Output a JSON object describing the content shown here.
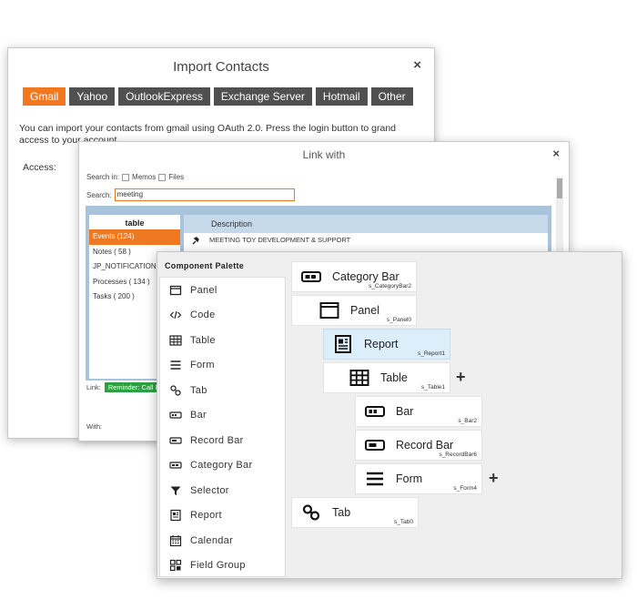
{
  "import_contacts": {
    "title": "Import Contacts",
    "close": "×",
    "tabs": [
      "Gmail",
      "Yahoo",
      "OutlookExpress",
      "Exchange Server",
      "Hotmail",
      "Other"
    ],
    "active_tab": "Gmail",
    "description": "You can import your contacts from gmail using OAuth 2.0. Press the login button to grand access to your account",
    "access_label": "Access:",
    "accent_color": "#f07820"
  },
  "link_with": {
    "title": "Link with",
    "close": "×",
    "search_in_label": "Search in:",
    "memos_label": "Memos",
    "files_label": "Files",
    "search_label": "Search:",
    "search_value": "meeting",
    "table_header": "table",
    "tables": [
      "Events (124)",
      "Notes ( 58 )",
      "JP_NOTIFICATIONS ( 0 )",
      "Processes ( 134 )",
      "Tasks ( 200 )"
    ],
    "desc_header": "Description",
    "rows": [
      "MEETING TOY DEVELOPMENT & SUPPORT"
    ],
    "link_label": "Link:",
    "reminder": "Reminder: Call M",
    "with_label": "With:"
  },
  "palette": {
    "title": "Component Palette",
    "items": [
      {
        "label": "Panel",
        "icon": "panel-icon"
      },
      {
        "label": "Code",
        "icon": "code-icon"
      },
      {
        "label": "Table",
        "icon": "table-icon"
      },
      {
        "label": "Form",
        "icon": "form-icon"
      },
      {
        "label": "Tab",
        "icon": "tab-icon"
      },
      {
        "label": "Bar",
        "icon": "bar-icon"
      },
      {
        "label": "Record Bar",
        "icon": "record-bar-icon"
      },
      {
        "label": "Category Bar",
        "icon": "category-bar-icon"
      },
      {
        "label": "Selector",
        "icon": "filter-icon"
      },
      {
        "label": "Report",
        "icon": "report-icon"
      },
      {
        "label": "Calendar",
        "icon": "calendar-icon"
      },
      {
        "label": "Field Group",
        "icon": "field-group-icon"
      }
    ]
  },
  "tree": {
    "nodes": [
      {
        "label": "Category Bar",
        "id": "s_CategoryBar2"
      },
      {
        "label": "Panel",
        "id": "s_Panel0"
      },
      {
        "label": "Report",
        "id": "s_Report1"
      },
      {
        "label": "Table",
        "id": "s_Table1"
      },
      {
        "label": "Bar",
        "id": "s_Bar2"
      },
      {
        "label": "Record Bar",
        "id": "s_RecordBar6"
      },
      {
        "label": "Form",
        "id": "s_Form4"
      },
      {
        "label": "Tab",
        "id": "s_Tab0"
      }
    ],
    "plus": "+",
    "expand_glyph": "◢"
  }
}
